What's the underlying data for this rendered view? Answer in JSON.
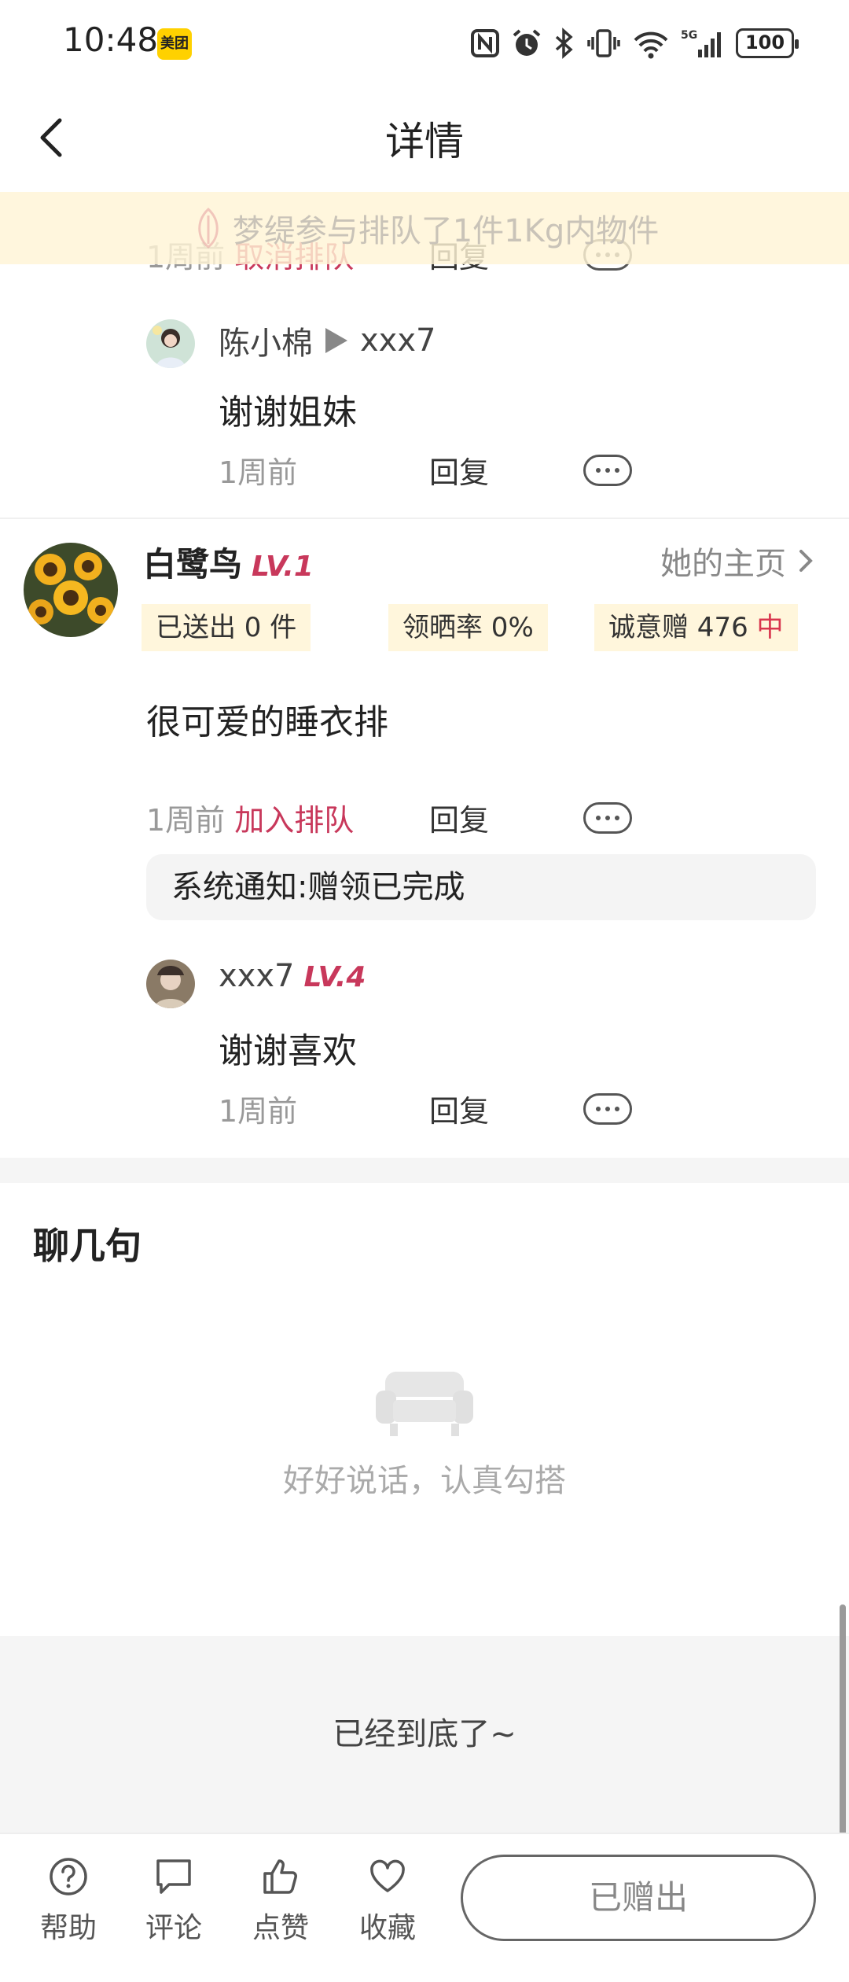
{
  "status": {
    "time": "10:48",
    "app_badge": "美团",
    "battery": "100"
  },
  "nav": {
    "title": "详情"
  },
  "notice": {
    "text": "梦缇参与排队了1件1Kg内物件"
  },
  "prev_comment": {
    "time": "1周前",
    "action": "取消排队",
    "reply": "回复"
  },
  "reply1": {
    "from": "陈小棉",
    "to": "xxx7",
    "text": "谢谢姐妹",
    "time": "1周前",
    "reply": "回复"
  },
  "comment": {
    "user": "白鹭鸟",
    "level": "LV.1",
    "homepage": "她的主页",
    "stats": {
      "sent": "已送出 0 件",
      "rate": "领晒率 0%",
      "sincerity_prefix": "诚意赠 476 ",
      "sincerity_level": "中"
    },
    "text": "很可爱的睡衣排",
    "time": "1周前",
    "action": "加入排队",
    "reply": "回复",
    "system": "系统通知:赠领已完成"
  },
  "reply2": {
    "user": "xxx7",
    "level": "LV.4",
    "text": "谢谢喜欢",
    "time": "1周前",
    "reply": "回复"
  },
  "chat": {
    "title": "聊几句",
    "empty": "好好说话，认真勾搭"
  },
  "end_text": "已经到底了~",
  "toolbar": {
    "help": "帮助",
    "comment": "评论",
    "like": "点赞",
    "favorite": "收藏",
    "gift_button": "已赠出"
  },
  "colors": {
    "accent_red": "#c8385b",
    "notice_bg": "#fff4d6",
    "tag_bg": "#fff6dc"
  }
}
